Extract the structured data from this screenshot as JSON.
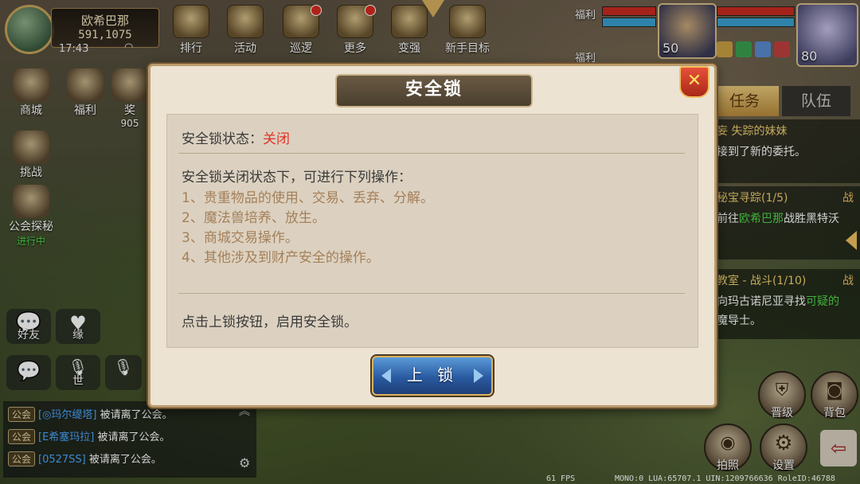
{
  "player": {
    "name": "欧希巴那",
    "id": "591,1075",
    "time": "17:43"
  },
  "top_menu": [
    "排行",
    "活动",
    "巡逻",
    "更多",
    "变强",
    "新手目标"
  ],
  "left_menu": {
    "shop": "商城",
    "welfare": "福利",
    "reward_partial": "奖",
    "reward_count": "905",
    "challenge": "挑战",
    "guild_explore": "公会探秘",
    "guild_status": "进行中"
  },
  "social": {
    "friends": "好友",
    "fate": "缘",
    "world": "世"
  },
  "chat": [
    {
      "tag": "公会",
      "who": "[◎玛尔缇塔]",
      "text": "被请离了公会。"
    },
    {
      "tag": "公会",
      "who": "[E希塞玛拉]",
      "text": "被请离了公会。"
    },
    {
      "tag": "公会",
      "who": "[0527SS]",
      "text": "被请离了公会。"
    }
  ],
  "top_right": {
    "welfare_a": "福利",
    "welfare_b": "福利",
    "pet_level": "50",
    "hero_level": "80"
  },
  "quest_panel": {
    "tab_task": "任务",
    "tab_team": "队伍",
    "items": [
      {
        "title": "妄 失踪的妹妹",
        "desc": "接到了新的委托。",
        "badge": ""
      },
      {
        "title": "秘宝寻踪(1/5)",
        "desc_pre": "前往",
        "desc_hl": "欧希巴那",
        "desc_post": "战胜黑特沃",
        "badge": "战"
      },
      {
        "title": "教室 - 战斗(1/10)",
        "desc_pre": "向玛古诺尼亚寻找",
        "desc_hl": "可疑的",
        "desc2": "魔导士。",
        "badge": "战"
      }
    ]
  },
  "right_buttons": {
    "upgrade": "晋级",
    "bag": "背包",
    "photo": "拍照",
    "settings": "设置"
  },
  "debug": {
    "fps": "61 FPS",
    "info": "MONO:0 LUA:65707.1 UIN:1209766636 RoleID:46788"
  },
  "dialog": {
    "title": "安全锁",
    "status_label": "安全锁状态：",
    "status_value": "关闭",
    "intro": "安全锁关闭状态下，可进行下列操作：",
    "operations": [
      "1、贵重物品的使用、交易、丢弃、分解。",
      "2、魔法兽培养、放生。",
      "3、商城交易操作。",
      "4、其他涉及到财产安全的操作。"
    ],
    "hint": "点击上锁按钮，启用安全锁。",
    "lock_button": "上 锁"
  }
}
